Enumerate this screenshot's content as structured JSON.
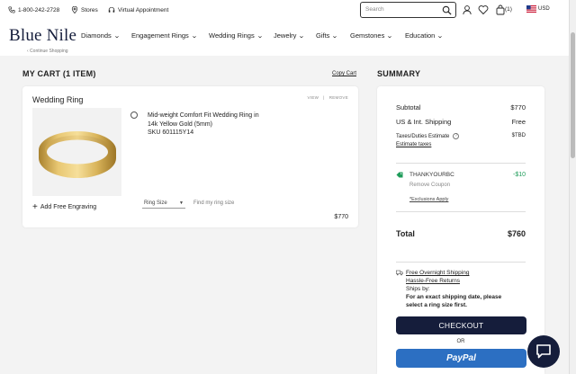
{
  "header": {
    "phone": "1-800-242-2728",
    "stores": "Stores",
    "virtual": "Virtual Appointment",
    "search_placeholder": "Search",
    "cart_count": "(1)",
    "currency": "USD",
    "logo": "Blue Nile",
    "nav": [
      {
        "label": "Diamonds"
      },
      {
        "label": "Engagement Rings"
      },
      {
        "label": "Wedding Rings"
      },
      {
        "label": "Jewelry"
      },
      {
        "label": "Gifts"
      },
      {
        "label": "Gemstones"
      },
      {
        "label": "Education"
      }
    ]
  },
  "page": {
    "breadcrumb": "‹ Continue Shopping",
    "cart_title": "MY CART (1 ITEM)",
    "copy_cart": "Copy Cart",
    "summary_title": "SUMMARY"
  },
  "item": {
    "title": "Wedding Ring",
    "view": "VIEW",
    "separator": "|",
    "remove": "REMOVE",
    "name_line1": "Mid-weight Comfort Fit Wedding Ring in",
    "name_line2": "14k Yellow Gold (5mm)",
    "sku": "SKU 601115Y14",
    "add_engraving": "Add Free Engraving",
    "ring_size": "Ring Size",
    "find_size": "Find my ring size",
    "price": "$770"
  },
  "summary": {
    "subtotal_label": "Subtotal",
    "subtotal": "$770",
    "shipping_label": "US & Int. Shipping",
    "shipping": "Free",
    "taxes_label": "Taxes/Duties Estimate",
    "taxes": "$TBD",
    "estimate_taxes": "Estimate taxes",
    "coupon_code": "THANKYOURBC",
    "coupon_discount": "-$10",
    "remove_coupon": "Remove Coupon",
    "exclusions": "*Exclusions Apply",
    "total_label": "Total",
    "total": "$760",
    "free_shipping": "Free Overnight Shipping",
    "returns": "Hassle-Free Returns",
    "ships_by": "Ships by:",
    "ship_note_1": "For an exact shipping date, please",
    "ship_note_2": "select a ring size first.",
    "checkout": "CHECKOUT",
    "or": "OR",
    "paypal": "PayPal"
  },
  "colors": {
    "brand_navy": "#151d3b",
    "paypal_blue": "#2c6fc2",
    "discount_green": "#1f9c5a",
    "ring_gold": "#d9b45a"
  },
  "icons": [
    "phone-icon",
    "pin-icon",
    "headset-icon",
    "search-icon",
    "user-icon",
    "heart-icon",
    "bag-icon",
    "us-flag-icon",
    "ring-image",
    "tag-icon",
    "truck-icon",
    "chat-icon"
  ]
}
